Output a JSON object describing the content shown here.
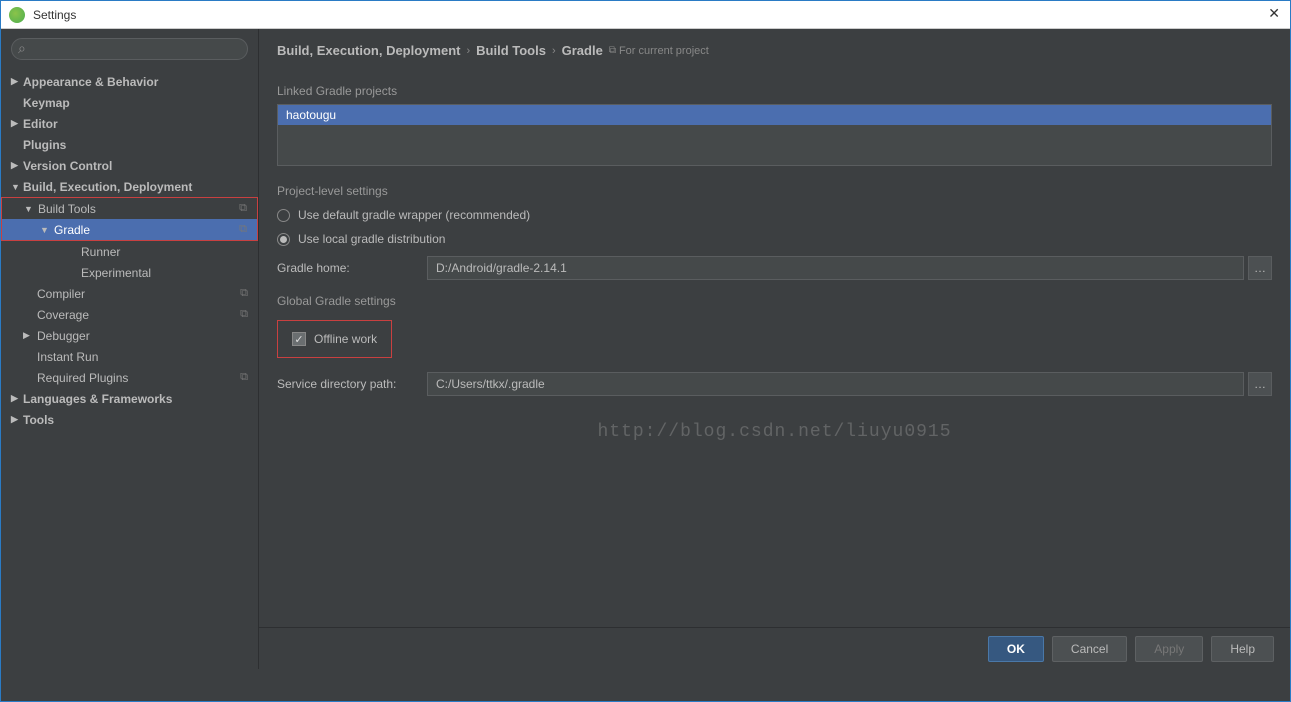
{
  "window": {
    "title": "Settings"
  },
  "sidebar": {
    "items": {
      "appearance": "Appearance & Behavior",
      "keymap": "Keymap",
      "editor": "Editor",
      "plugins": "Plugins",
      "version_control": "Version Control",
      "build": "Build, Execution, Deployment",
      "build_tools": "Build Tools",
      "gradle": "Gradle",
      "runner": "Runner",
      "experimental": "Experimental",
      "compiler": "Compiler",
      "coverage": "Coverage",
      "debugger": "Debugger",
      "instant_run": "Instant Run",
      "required_plugins": "Required Plugins",
      "languages": "Languages & Frameworks",
      "tools": "Tools"
    }
  },
  "breadcrumb": {
    "a": "Build, Execution, Deployment",
    "b": "Build Tools",
    "c": "Gradle",
    "scope": "For current project"
  },
  "panel": {
    "linked_label": "Linked Gradle projects",
    "project_name": "haotougu",
    "project_level_label": "Project-level settings",
    "radio_default": "Use default gradle wrapper (recommended)",
    "radio_local": "Use local gradle distribution",
    "gradle_home_label": "Gradle home:",
    "gradle_home_value": "D:/Android/gradle-2.14.1",
    "global_label": "Global Gradle settings",
    "offline_label": "Offline work",
    "service_dir_label": "Service directory path:",
    "service_dir_value": "C:/Users/ttkx/.gradle",
    "watermark": "http://blog.csdn.net/liuyu0915"
  },
  "footer": {
    "ok": "OK",
    "cancel": "Cancel",
    "apply": "Apply",
    "help": "Help"
  }
}
